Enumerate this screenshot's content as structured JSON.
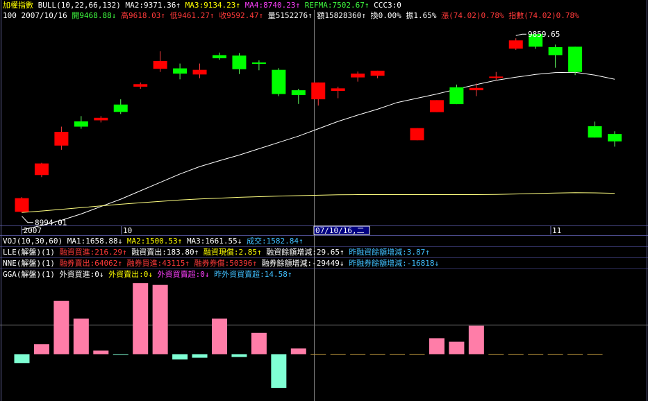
{
  "header": {
    "index_name": "加權指數",
    "bull": "BULL(10,22,66,132)",
    "ma2": "MA2:9371.36↑",
    "ma3": "MA3:9134.23↑",
    "ma4": "MA4:8740.23↑",
    "refma": "REFMA:7502.67↑",
    "ccc3": "CCC3:0"
  },
  "quote": {
    "code": "100",
    "date": "2007/10/16",
    "open": "開9468.88↓",
    "high": "高9618.03↑",
    "low": "低9461.27↑",
    "close": "收9592.47↑",
    "volume": "量5152276↑",
    "amount": "額15828360↑",
    "turnover": "換0.00%",
    "amplitude": "振1.65%",
    "change": "漲(74.02)0.78%",
    "index_change": "指數(74.02)0.78%"
  },
  "time_axis": {
    "label_2007": "2007",
    "label_10": "10",
    "label_cursor": "07/10/16,二",
    "label_11": "11"
  },
  "indicators": {
    "voj": {
      "name": "VOJ(10,30,60)",
      "ma1": "MA1:1658.88↓",
      "ma2": "MA2:1500.53↑",
      "ma3": "MA3:1661.55↓",
      "vol": "成交:1582.84↑"
    },
    "lle": {
      "name": "LLE(解盤)(1)",
      "a": "融資買進:216.29↑",
      "b": "融資賣出:183.80↑",
      "c": "融資現償:2.85↑",
      "d": "融資餘額增減:29.65↑",
      "e": "昨融資餘額增減:3.87↑"
    },
    "nne": {
      "name": "NNE(解盤)(1)",
      "a": "融券賣出:64062↑",
      "b": "融券買進:43115↑",
      "c": "融券券償:50396↑",
      "d": "融券餘額增減:-29449↓",
      "e": "昨融券餘額增減:-16818↓"
    },
    "gga": {
      "name": "GGA(解盤)(1)",
      "a": "外資買進:0↓",
      "b": "外資賣出:0↓",
      "c": "外資買賣超:0↓",
      "d": "昨外資買賣超:14.58↑"
    }
  },
  "colors": {
    "up": "#ff0000",
    "down": "#00ff00",
    "pink": "#ff7da8",
    "aqua": "#7fffd4",
    "ma_white": "#ffffff",
    "ma_yellow": "#ffff80",
    "grid": "#4a4a8a"
  },
  "chart_data": [
    {
      "type": "candlestick",
      "title": "加權指數",
      "annotations": [
        {
          "text": "8994.01",
          "value": 8994.01
        },
        {
          "text": "9859.65",
          "value": 9859.65
        }
      ],
      "ylim": [
        8960,
        9900
      ],
      "candles": [
        {
          "open": 9015,
          "close": 9080,
          "high": 9085,
          "low": 9010
        },
        {
          "open": 9190,
          "close": 9245,
          "high": 9248,
          "low": 9180
        },
        {
          "open": 9330,
          "close": 9395,
          "high": 9420,
          "low": 9310
        },
        {
          "open": 9445,
          "close": 9420,
          "high": 9470,
          "low": 9410
        },
        {
          "open": 9450,
          "close": 9462,
          "high": 9470,
          "low": 9440
        },
        {
          "open": 9525,
          "close": 9490,
          "high": 9550,
          "low": 9480
        },
        {
          "open": 9610,
          "close": 9622,
          "high": 9630,
          "low": 9600
        },
        {
          "open": 9695,
          "close": 9732,
          "high": 9778,
          "low": 9680
        },
        {
          "open": 9697,
          "close": 9672,
          "high": 9720,
          "low": 9645
        },
        {
          "open": 9668,
          "close": 9690,
          "high": 9720,
          "low": 9650
        },
        {
          "open": 9760,
          "close": 9745,
          "high": 9772,
          "low": 9738
        },
        {
          "open": 9758,
          "close": 9693,
          "high": 9770,
          "low": 9670
        },
        {
          "open": 9725,
          "close": 9722,
          "high": 9735,
          "low": 9688
        },
        {
          "open": 9690,
          "close": 9575,
          "high": 9698,
          "low": 9565
        },
        {
          "open": 9593,
          "close": 9570,
          "high": 9600,
          "low": 9528
        },
        {
          "open": 9550,
          "close": 9630,
          "high": 9630,
          "low": 9520
        },
        {
          "open": 9590,
          "close": 9602,
          "high": 9610,
          "low": 9555
        },
        {
          "open": 9654,
          "close": 9672,
          "high": 9682,
          "low": 9634
        },
        {
          "open": 9662,
          "close": 9686,
          "high": 9686,
          "low": 9650
        },
        null,
        {
          "open": 9355,
          "close": 9413,
          "high": 9413,
          "low": 9355
        },
        {
          "open": 9489,
          "close": 9546,
          "high": 9546,
          "low": 9489
        },
        {
          "open": 9607,
          "close": 9527,
          "high": 9620,
          "low": 9527
        },
        {
          "open": 9593,
          "close": 9604,
          "high": 9625,
          "low": 9565
        },
        {
          "open": 9655,
          "close": 9658,
          "high": 9680,
          "low": 9640
        },
        {
          "open": 9791,
          "close": 9830,
          "high": 9840,
          "low": 9785
        },
        {
          "open": 9860,
          "close": 9800,
          "high": 9860,
          "low": 9790
        },
        {
          "open": 9798,
          "close": 9760,
          "high": 9810,
          "low": 9700
        },
        {
          "open": 9800,
          "close": 9680,
          "high": 9800,
          "low": 9665
        },
        {
          "open": 9422,
          "close": 9368,
          "high": 9444,
          "low": 9368
        },
        {
          "open": 9385,
          "close": 9350,
          "high": 9398,
          "low": 9325
        }
      ],
      "ma_white": [
        8930,
        8950,
        8975,
        9005,
        9040,
        9075,
        9115,
        9155,
        9195,
        9230,
        9258,
        9285,
        9315,
        9345,
        9375,
        9410,
        9445,
        9475,
        9503,
        9535,
        9555,
        9575,
        9598,
        9620,
        9640,
        9655,
        9668,
        9677,
        9678,
        9665,
        9645
      ],
      "ma_yellow": [
        9012,
        9019,
        9027,
        9035,
        9043,
        9051,
        9058,
        9065,
        9071,
        9076,
        9080,
        9084,
        9087,
        9090,
        9092,
        9094,
        9096,
        9097,
        9097,
        9097,
        9097,
        9097,
        9097,
        9097,
        9098,
        9100,
        9102,
        9104,
        9106,
        9105,
        9103
      ]
    },
    {
      "type": "bar",
      "title": "GGA(解盤)(1)",
      "ylim": [
        -100,
        210
      ],
      "values": [
        -25,
        28,
        150,
        100,
        10,
        -2,
        200,
        195,
        -15,
        -10,
        100,
        -8,
        60,
        -95,
        16,
        -1,
        -1,
        -1,
        -1,
        -1,
        -1,
        45,
        35,
        80,
        -1,
        -1,
        -1,
        -1,
        -1,
        -1
      ]
    }
  ]
}
